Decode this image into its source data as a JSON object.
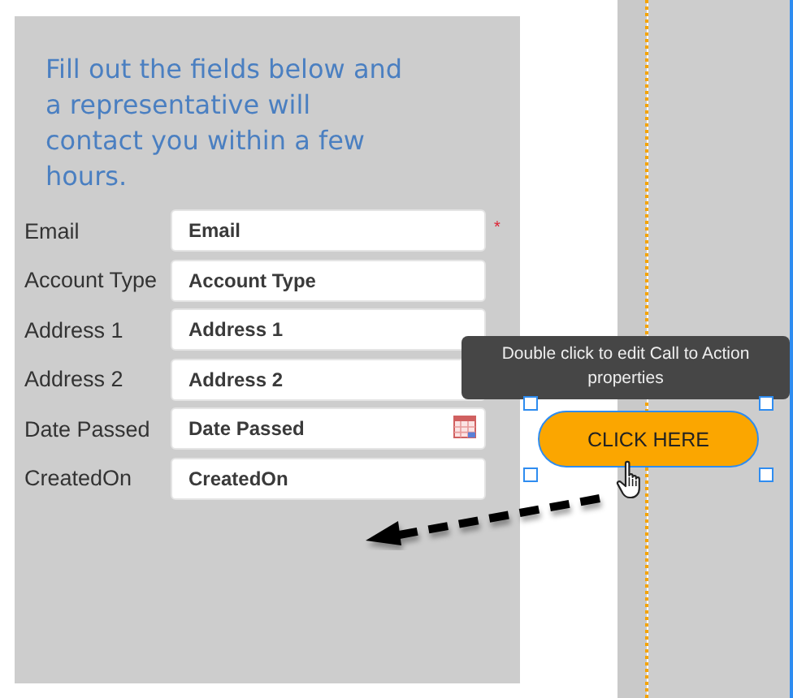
{
  "heading": "Fill out the fields below and a representative will contact you within a few hours.",
  "fields": [
    {
      "label": "Email",
      "placeholder": "Email",
      "kind": "text",
      "required_mark": "*"
    },
    {
      "label": "Account Type",
      "placeholder": "Account Type",
      "kind": "text"
    },
    {
      "label": "Address 1",
      "placeholder": "Address 1",
      "kind": "text"
    },
    {
      "label": "Address 2",
      "placeholder": "Address 2",
      "kind": "text"
    },
    {
      "label": "Date Passed",
      "placeholder": "Date Passed",
      "kind": "date"
    },
    {
      "label": "CreatedOn",
      "placeholder": "CreatedOn",
      "kind": "text"
    }
  ],
  "tooltip": "Double click to edit Call to Action properties",
  "cta_button": {
    "label": "CLICK HERE",
    "selected": true
  }
}
